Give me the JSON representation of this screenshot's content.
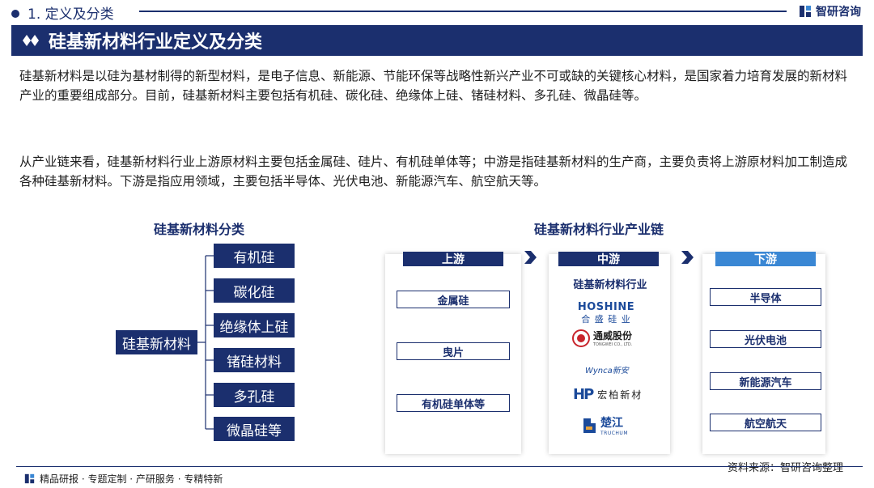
{
  "header": {
    "section": "1. 定义及分类",
    "brand": "智研咨询"
  },
  "banner": {
    "title": "硅基新材料行业定义及分类"
  },
  "paragraphs": [
    "硅基新材料是以硅为基材制得的新型材料，是电子信息、新能源、节能环保等战略性新兴产业不可或缺的关键核心材料，是国家着力培育发展的新材料产业的重要组成部分。目前，硅基新材料主要包括有机硅、碳化硅、绝缘体上硅、锗硅材料、多孔硅、微晶硅等。",
    "从产业链来看，硅基新材料行业上游原材料主要包括金属硅、硅片、有机硅单体等；中游是指硅基新材料的生产商，主要负责将上游原材料加工制造成各种硅基新材料。下游是指应用领域，主要包括半导体、光伏电池、新能源汽车、航空航天等。"
  ],
  "classification": {
    "title": "硅基新材料分类",
    "root": "硅基新材料",
    "items": [
      "有机硅",
      "碳化硅",
      "绝缘体上硅",
      "锗硅材料",
      "多孔硅",
      "微晶硅等"
    ]
  },
  "chain": {
    "title": "硅基新材料行业产业链",
    "upstream": {
      "label": "上游",
      "items": [
        "金属硅",
        "曳片",
        "有机硅单体等"
      ]
    },
    "midstream": {
      "label": "中游",
      "industry": "硅基新材料行业",
      "logos": {
        "hoshine_en": "HOSHINE",
        "hoshine_cn": "合 盛 硅 业",
        "tongwei_cn": "通威股份",
        "tongwei_en": "TONGWEI CO., LTD.",
        "wynca": "Wynca新安",
        "hp_mark": "HP",
        "hp_cn": "宏柏新材",
        "truchum_cn": "楚江",
        "truchum_en": "TRUCHUM"
      }
    },
    "downstream": {
      "label": "下游",
      "items": [
        "半导体",
        "光伏电池",
        "新能源汽车",
        "航空航天"
      ]
    }
  },
  "footer": {
    "services": "精品研报 · 专题定制 · 产研服务 · 专精特新",
    "source": "资料来源：智研咨询整理"
  },
  "colors": {
    "navy": "#1b2f6e",
    "accent": "#3a87d4",
    "tongwei_red": "#c8242b"
  }
}
